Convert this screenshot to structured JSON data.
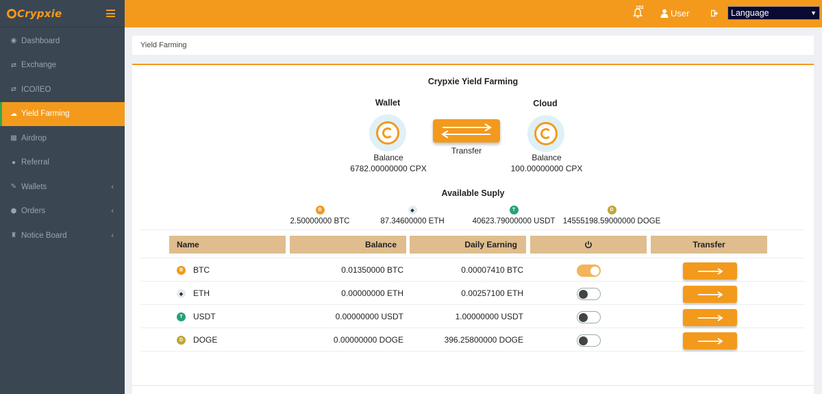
{
  "app": {
    "logo_text": "Crypxie"
  },
  "sidebar": {
    "items": [
      {
        "label": "Dashboard",
        "icon": "dashboard-icon"
      },
      {
        "label": "Exchange",
        "icon": "exchange-icon"
      },
      {
        "label": "ICO/IEO",
        "icon": "exchange-icon"
      },
      {
        "label": "Yield Farming",
        "icon": "cloud-icon",
        "active": true
      },
      {
        "label": "Airdrop",
        "icon": "gift-icon"
      },
      {
        "label": "Referral",
        "icon": "users-icon"
      },
      {
        "label": "Wallets",
        "icon": "pen-icon",
        "has_submenu": true
      },
      {
        "label": "Orders",
        "icon": "cube-icon",
        "has_submenu": true
      },
      {
        "label": "Notice Board",
        "icon": "bank-icon",
        "has_submenu": true
      }
    ]
  },
  "topbar": {
    "notification_count": "102",
    "user_label": "User",
    "language_label": "Language"
  },
  "breadcrumb": "Yield Farming",
  "farming": {
    "title": "Crypxie Yield Farming",
    "wallet_title": "Wallet",
    "cloud_title": "Cloud",
    "wallet_balance_label": "Balance",
    "wallet_balance_value": "6782.00000000 CPX",
    "cloud_balance_label": "Balance",
    "cloud_balance_value": "100.00000000 CPX",
    "transfer_label": "Transfer"
  },
  "supply": {
    "title": "Available Suply",
    "items": [
      {
        "coin": "BTC",
        "value": "2.50000000 BTC",
        "color": "#f39a1d"
      },
      {
        "coin": "ETH",
        "value": "87.34600000 ETH",
        "color": "#555555"
      },
      {
        "coin": "USDT",
        "value": "40623.79000000 USDT",
        "color": "#26a17b"
      },
      {
        "coin": "DOGE",
        "value": "14555198.59000000 DOGE",
        "color": "#c2a633"
      }
    ]
  },
  "table": {
    "headers": {
      "name": "Name",
      "balance": "Balance",
      "earning": "Daily Earning",
      "transfer": "Transfer"
    },
    "rows": [
      {
        "name": "BTC",
        "balance": "0.01350000 BTC",
        "earning": "0.00007410 BTC",
        "enabled": true,
        "color": "#f39a1d"
      },
      {
        "name": "ETH",
        "balance": "0.00000000 ETH",
        "earning": "0.00257100 ETH",
        "enabled": false,
        "color": "#555555"
      },
      {
        "name": "USDT",
        "balance": "0.00000000 USDT",
        "earning": "1.00000000 USDT",
        "enabled": false,
        "color": "#26a17b"
      },
      {
        "name": "DOGE",
        "balance": "0.00000000 DOGE",
        "earning": "396.25800000 DOGE",
        "enabled": false,
        "color": "#c2a633"
      }
    ]
  },
  "colors": {
    "accent": "#f39a1d",
    "sidebar": "#3b4653",
    "header_cell": "#dfbd8e"
  }
}
